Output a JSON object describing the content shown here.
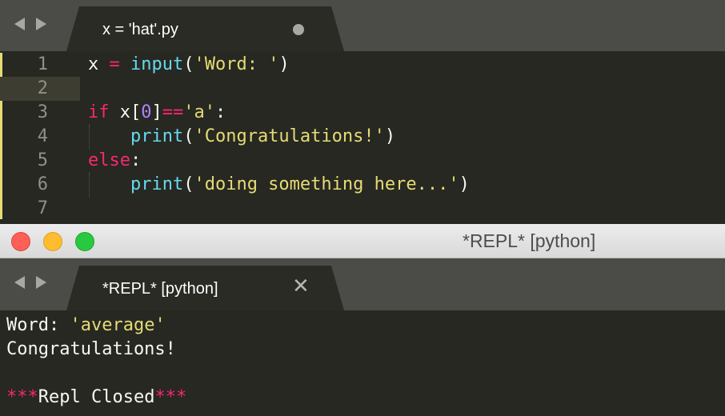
{
  "editor_tab": {
    "title": "x = 'hat'.py"
  },
  "code": {
    "line_numbers": [
      "1",
      "2",
      "3",
      "4",
      "5",
      "6",
      "7"
    ],
    "l1": {
      "var": "x",
      "eq": " = ",
      "fn": "input",
      "open": "(",
      "str": "'Word: '",
      "close": ")"
    },
    "l3": {
      "kw": "if",
      "sp": " x[",
      "num": "0",
      "br": "]",
      "op": "==",
      "str": "'a'",
      "colon": ":"
    },
    "l4": {
      "indent": "    ",
      "fn": "print",
      "open": "(",
      "str": "'Congratulations!'",
      "close": ")"
    },
    "l5": {
      "kw": "else",
      "colon": ":"
    },
    "l6": {
      "indent": "    ",
      "fn": "print",
      "open": "(",
      "str": "'doing something here...'",
      "close": ")"
    }
  },
  "window": {
    "title": "*REPL* [python]"
  },
  "repl_tab": {
    "title": "*REPL* [python]"
  },
  "repl_output": {
    "line1_label": "Word: ",
    "line1_value": "'average'",
    "line2": "Congratulations!",
    "closed_stars_left": "***",
    "closed_text": "Repl Closed",
    "closed_stars_right": "***"
  },
  "colors": {
    "background": "#272822",
    "keyword": "#f92672",
    "function": "#66d9ef",
    "string": "#e6db74",
    "number": "#ae81ff",
    "text": "#f8f8f2"
  }
}
